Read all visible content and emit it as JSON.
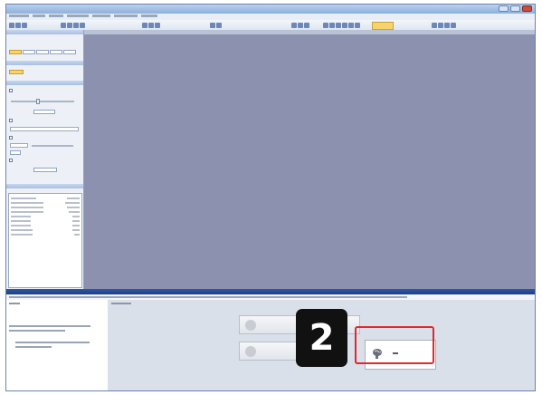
{
  "step_badge": {
    "number": "2"
  },
  "colors": {
    "canvas": "#8c91b0",
    "callout_frame": "#e0292e",
    "title_bar": "#2f55a6",
    "badge": "#111111"
  },
  "icons": {
    "ok": "brain-icon",
    "cancel": "disc-icon",
    "scan": "scanner-icon"
  }
}
